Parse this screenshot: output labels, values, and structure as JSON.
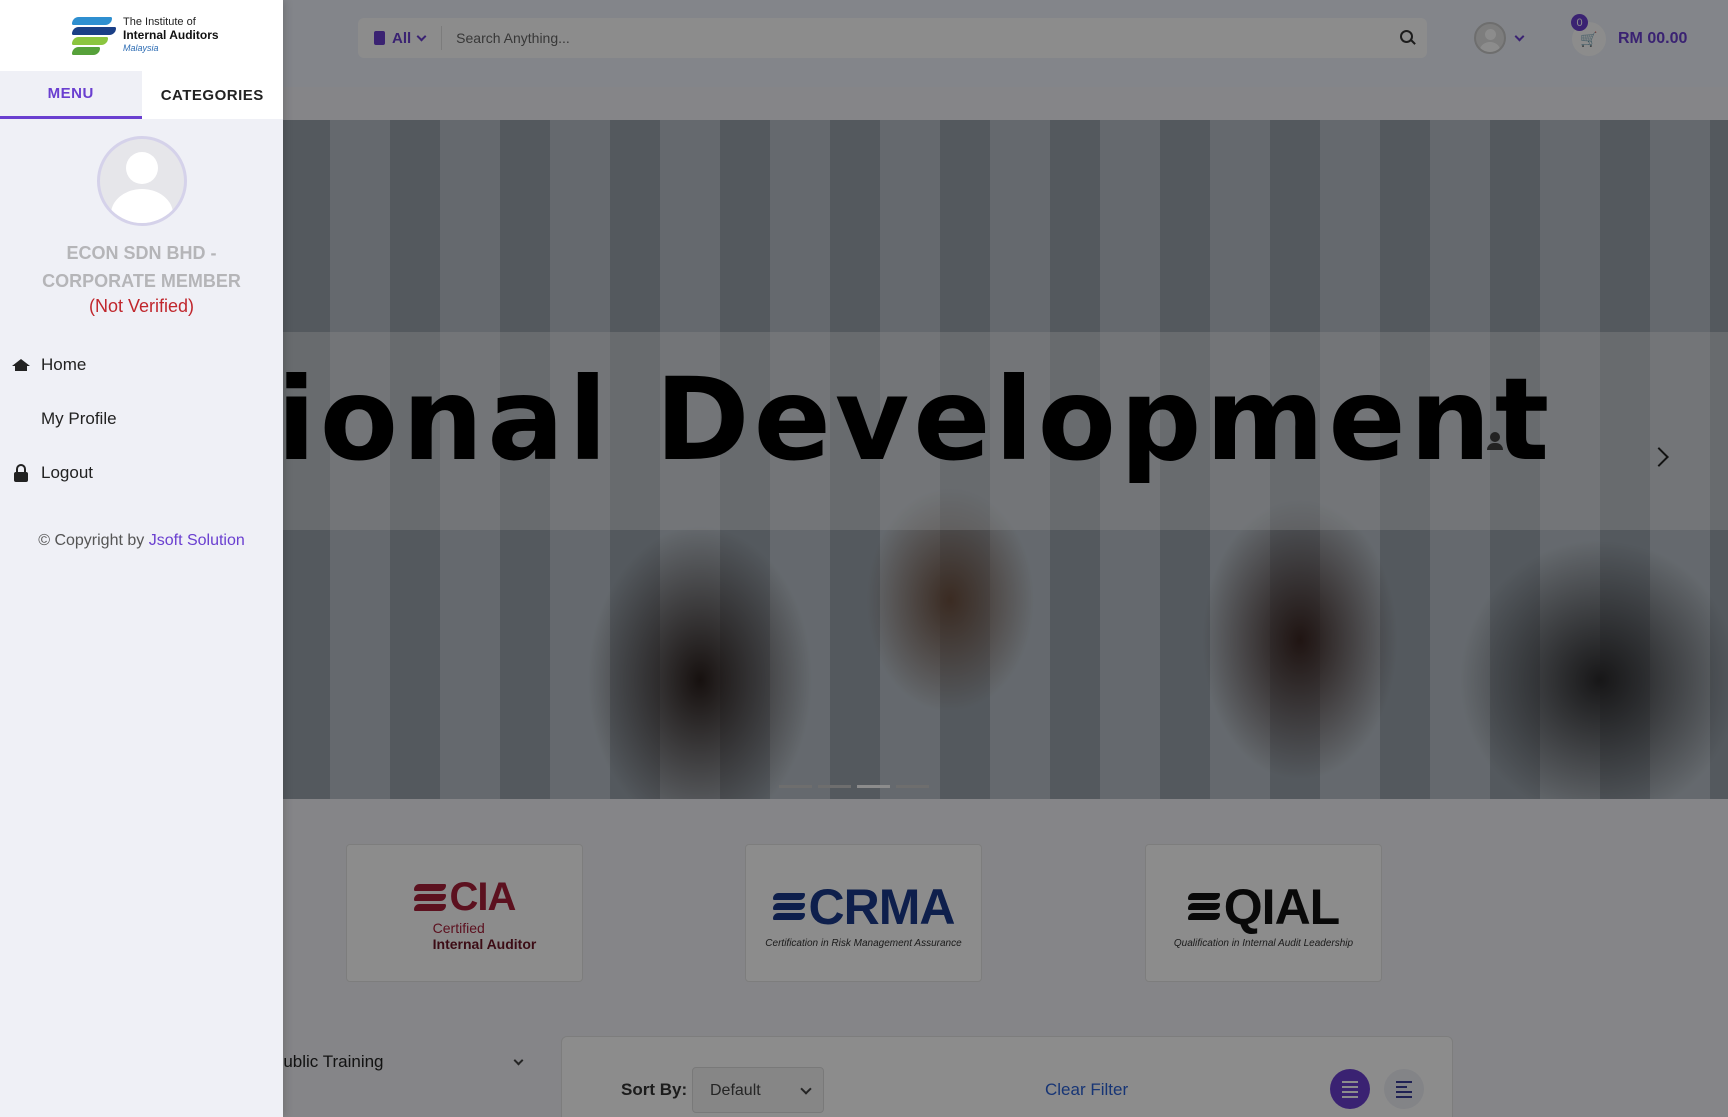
{
  "header": {
    "search_category": "All",
    "search_placeholder": "Search Anything...",
    "cart_count": "0",
    "cart_total": "RM 00.00"
  },
  "hero": {
    "headline": "Professional Development",
    "slide_count": 4,
    "active_slide": 3
  },
  "certifications": [
    {
      "title": "CIA",
      "sub_line1": "Certified",
      "sub_line2": "Internal Auditor"
    },
    {
      "title": "CRMA",
      "subtitle": "Certification in Risk Management Assurance"
    },
    {
      "title": "QIAL",
      "subtitle": "Qualification in Internal Audit Leadership"
    }
  ],
  "filters": {
    "training_type": "Public Training",
    "sort_label": "Sort By:",
    "sort_value": "Default",
    "clear_label": "Clear Filter"
  },
  "drawer": {
    "logo": {
      "line1": "The Institute of",
      "line2": "Internal Auditors",
      "line3": "Malaysia"
    },
    "tabs": [
      {
        "label": "MENU",
        "active": true
      },
      {
        "label": "CATEGORIES",
        "active": false
      }
    ],
    "organization": "ECON SDN BHD - CORPORATE MEMBER",
    "status": "(Not Verified)",
    "menu": [
      {
        "label": "Home",
        "icon": "home-icon"
      },
      {
        "label": "My Profile",
        "icon": "user-icon"
      },
      {
        "label": "Logout",
        "icon": "lock-icon"
      }
    ],
    "copyright_prefix": "© Copyright by",
    "copyright_link": "Jsoft Solution"
  },
  "colors": {
    "accent": "#6a3fd0",
    "status_error": "#c0262c",
    "link": "#2b62d6"
  }
}
